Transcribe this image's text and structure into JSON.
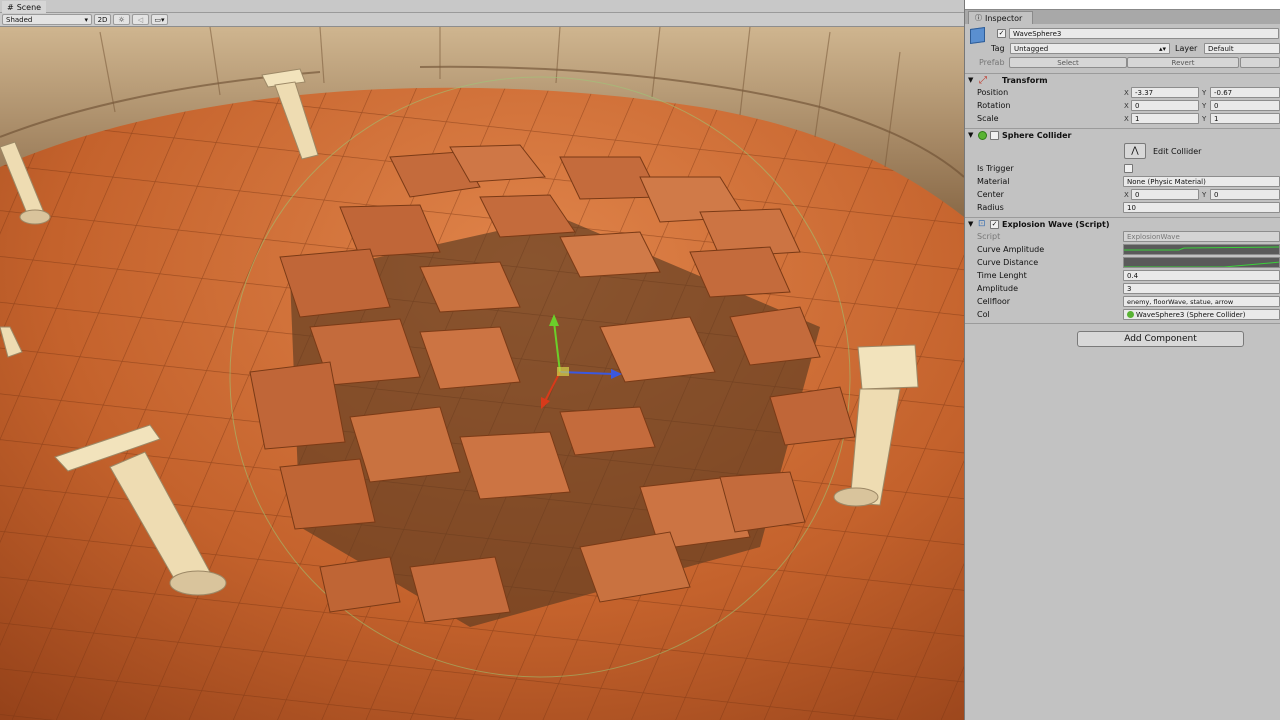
{
  "scene": {
    "tab_label": "Scene",
    "shading_mode": "Shaded",
    "mode_2d": "2D"
  },
  "inspector": {
    "tab_label": "Inspector",
    "object_name": "WaveSphere3",
    "tag_label": "Tag",
    "tag_value": "Untagged",
    "layer_label": "Layer",
    "layer_value": "Default",
    "prefab_label": "Prefab",
    "prefab_select": "Select",
    "prefab_revert": "Revert",
    "transform": {
      "title": "Transform",
      "position_label": "Position",
      "rotation_label": "Rotation",
      "scale_label": "Scale",
      "position": {
        "x": "-3.37",
        "y": "-0.67"
      },
      "rotation": {
        "x": "0",
        "y": "0"
      },
      "scale": {
        "x": "1",
        "y": "1"
      }
    },
    "sphere_collider": {
      "title": "Sphere Collider",
      "edit_collider": "Edit Collider",
      "is_trigger_label": "Is Trigger",
      "material_label": "Material",
      "material_value": "None (Physic Material)",
      "center_label": "Center",
      "center": {
        "x": "0",
        "y": "0"
      },
      "radius_label": "Radius",
      "radius_value": "10"
    },
    "explosion_wave": {
      "title": "Explosion Wave (Script)",
      "script_label": "Script",
      "script_value": "ExplosionWave",
      "curve_amplitude_label": "Curve Amplitude",
      "curve_distance_label": "Curve Distance",
      "time_label": "Time Lenght",
      "time_value": "0.4",
      "amplitude_label": "Amplitude",
      "amplitude_value": "3",
      "cellfloor_label": "Cellfloor",
      "cellfloor_value": "enemy, floorWave, statue, arrow",
      "col_label": "Col",
      "col_value": "WaveSphere3 (Sphere Collider)"
    },
    "add_component": "Add Component",
    "axis_x": "X",
    "axis_y": "Y"
  }
}
